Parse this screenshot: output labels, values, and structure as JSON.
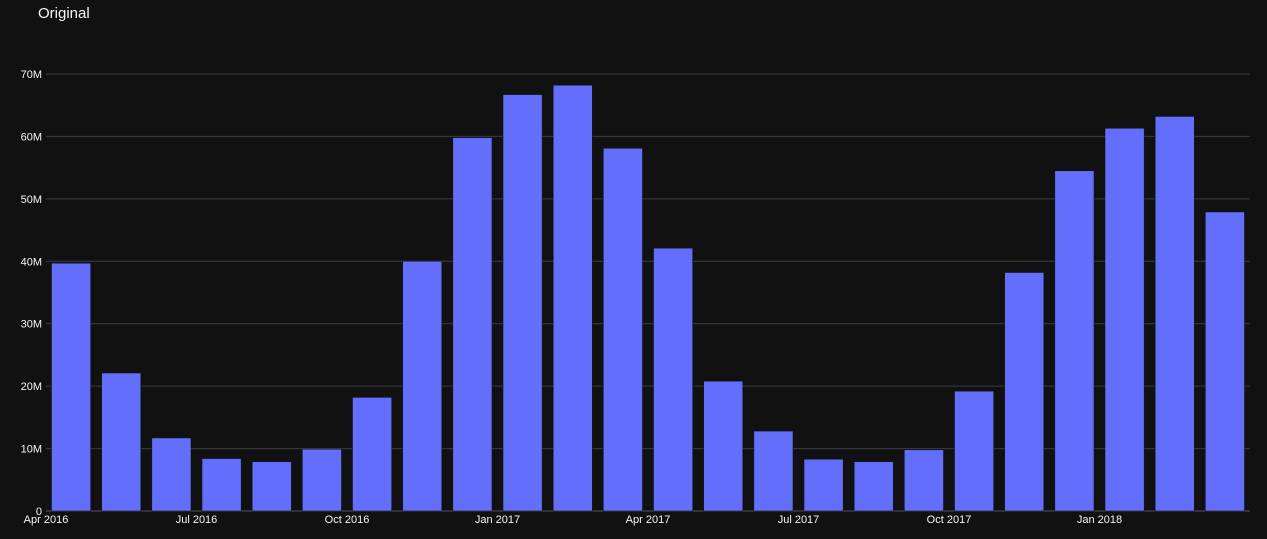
{
  "chart_data": {
    "type": "bar",
    "title": "Original",
    "xlabel": "",
    "ylabel": "",
    "ylim": [
      0,
      70000000
    ],
    "y_ticks": [
      {
        "value": 0,
        "label": "0"
      },
      {
        "value": 10000000,
        "label": "10M"
      },
      {
        "value": 20000000,
        "label": "20M"
      },
      {
        "value": 30000000,
        "label": "30M"
      },
      {
        "value": 40000000,
        "label": "40M"
      },
      {
        "value": 50000000,
        "label": "50M"
      },
      {
        "value": 60000000,
        "label": "60M"
      },
      {
        "value": 70000000,
        "label": "70M"
      }
    ],
    "x_ticks": [
      {
        "date": "2016-04-01",
        "label": "Apr 2016"
      },
      {
        "date": "2016-07-01",
        "label": "Jul 2016"
      },
      {
        "date": "2016-10-01",
        "label": "Oct 2016"
      },
      {
        "date": "2017-01-01",
        "label": "Jan 2017"
      },
      {
        "date": "2017-04-01",
        "label": "Apr 2017"
      },
      {
        "date": "2017-07-01",
        "label": "Jul 2017"
      },
      {
        "date": "2017-10-01",
        "label": "Oct 2017"
      },
      {
        "date": "2018-01-01",
        "label": "Jan 2018"
      }
    ],
    "grid": true,
    "legend": "none",
    "bar_color": "#636efa",
    "background": "#111111",
    "categories": [
      "2016-04",
      "2016-05",
      "2016-06",
      "2016-07",
      "2016-08",
      "2016-09",
      "2016-10",
      "2016-11",
      "2016-12",
      "2017-01",
      "2017-02",
      "2017-03",
      "2017-04",
      "2017-05",
      "2017-06",
      "2017-07",
      "2017-08",
      "2017-09",
      "2017-10",
      "2017-11",
      "2017-12",
      "2018-01",
      "2018-02",
      "2018-03"
    ],
    "values": [
      39700000,
      22100000,
      11700000,
      8400000,
      7900000,
      9900000,
      18200000,
      40000000,
      59800000,
      66700000,
      68200000,
      58100000,
      42100000,
      20800000,
      12800000,
      8300000,
      7900000,
      9800000,
      19200000,
      38200000,
      54500000,
      61300000,
      63200000,
      47900000
    ]
  }
}
